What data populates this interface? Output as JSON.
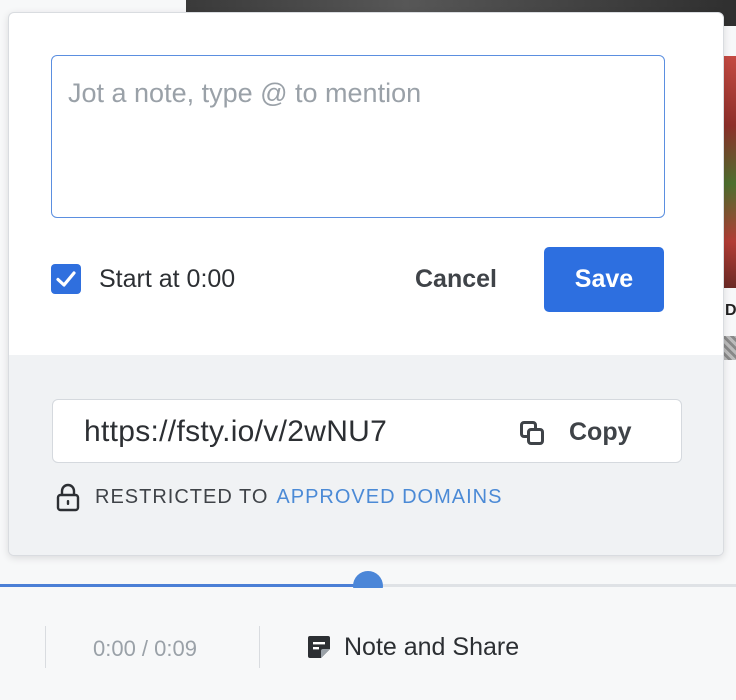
{
  "popover": {
    "note_placeholder": "Jot a note, type @ to mention",
    "start_at": {
      "checked": true,
      "label": "Start at 0:00"
    },
    "cancel_label": "Cancel",
    "save_label": "Save",
    "share": {
      "link": "https://fsty.io/v/2wNU7",
      "copy_label": "Copy",
      "restricted_prefix": "RESTRICTED TO",
      "restricted_link": "APPROVED DOMAINS"
    }
  },
  "background": {
    "partial_letter": "D"
  },
  "player": {
    "progress_fraction": 0.5,
    "time": "0:00 / 0:09",
    "note_share_label": "Note and Share"
  },
  "colors": {
    "accent": "#2d6fe0",
    "link": "#4b8ad6",
    "progress": "#4b86d8"
  },
  "icons": {
    "checkbox": "check-icon",
    "copy": "copy-icon",
    "lock": "lock-icon",
    "note_share": "note-icon"
  }
}
